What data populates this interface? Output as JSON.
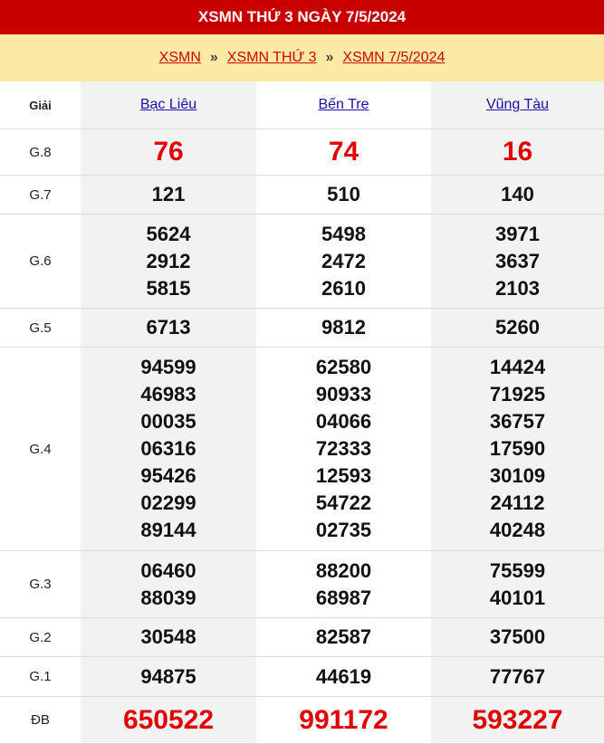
{
  "header": {
    "title": "XSMN THỨ 3 NGÀY 7/5/2024"
  },
  "breadcrumb": {
    "items": [
      "XSMN",
      "XSMN THỨ 3",
      "XSMN 7/5/2024"
    ],
    "separator": "»"
  },
  "table": {
    "label_header": "Giải",
    "provinces": [
      "Bạc Liêu",
      "Bến Tre",
      "Vũng Tàu"
    ],
    "rows": [
      {
        "label": "G.8",
        "values": [
          [
            "76"
          ],
          [
            "74"
          ],
          [
            "16"
          ]
        ]
      },
      {
        "label": "G.7",
        "values": [
          [
            "121"
          ],
          [
            "510"
          ],
          [
            "140"
          ]
        ]
      },
      {
        "label": "G.6",
        "values": [
          [
            "5624",
            "2912",
            "5815"
          ],
          [
            "5498",
            "2472",
            "2610"
          ],
          [
            "3971",
            "3637",
            "2103"
          ]
        ]
      },
      {
        "label": "G.5",
        "values": [
          [
            "6713"
          ],
          [
            "9812"
          ],
          [
            "5260"
          ]
        ]
      },
      {
        "label": "G.4",
        "values": [
          [
            "94599",
            "46983",
            "00035",
            "06316",
            "95426",
            "02299",
            "89144"
          ],
          [
            "62580",
            "90933",
            "04066",
            "72333",
            "12593",
            "54722",
            "02735"
          ],
          [
            "14424",
            "71925",
            "36757",
            "17590",
            "30109",
            "24112",
            "40248"
          ]
        ]
      },
      {
        "label": "G.3",
        "values": [
          [
            "06460",
            "88039"
          ],
          [
            "88200",
            "68987"
          ],
          [
            "75599",
            "40101"
          ]
        ]
      },
      {
        "label": "G.2",
        "values": [
          [
            "30548"
          ],
          [
            "82587"
          ],
          [
            "37500"
          ]
        ]
      },
      {
        "label": "G.1",
        "values": [
          [
            "94875"
          ],
          [
            "44619"
          ],
          [
            "77767"
          ]
        ]
      },
      {
        "label": "ĐB",
        "values": [
          [
            "650522"
          ],
          [
            "991172"
          ],
          [
            "593227"
          ]
        ]
      }
    ]
  },
  "colors": {
    "header_bg": "#c80000",
    "breadcrumb_bg": "#fde9a6",
    "highlight": "#e10000"
  }
}
